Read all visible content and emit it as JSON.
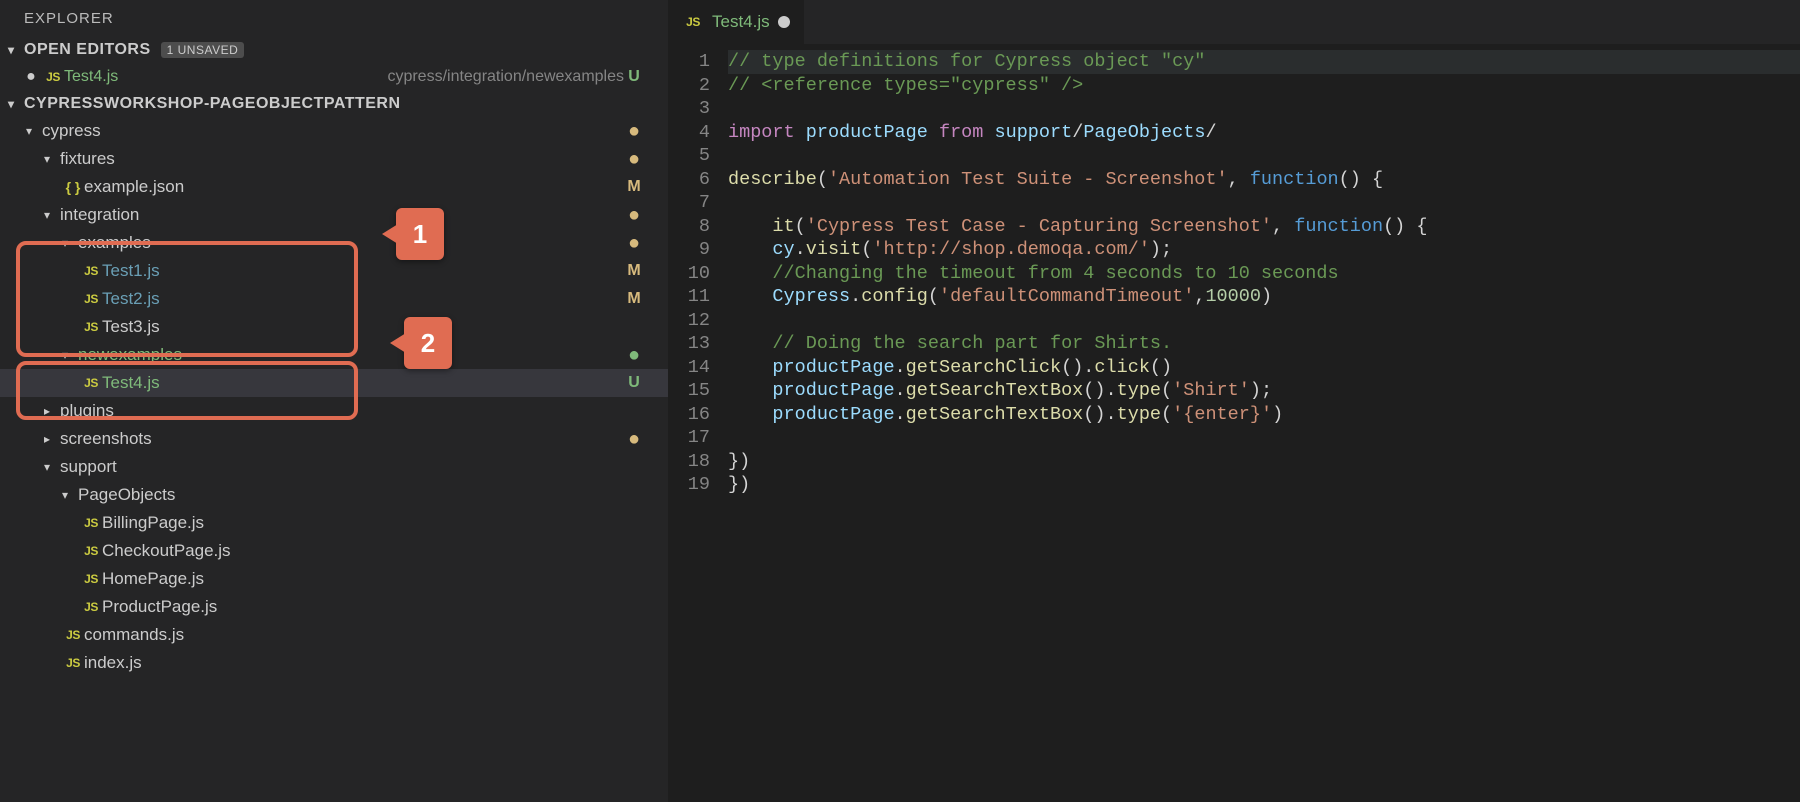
{
  "sidebar": {
    "title": "EXPLORER",
    "openEditors": {
      "label": "OPEN EDITORS",
      "unsavedBadge": "1 UNSAVED",
      "items": [
        {
          "name": "Test4.js",
          "path": "cypress/integration/newexamples",
          "git": "U"
        }
      ]
    },
    "workspace": {
      "name": "CYPRESSWORKSHOP-PAGEOBJECTPATTERN"
    },
    "tree": [
      {
        "type": "folder",
        "name": "cypress",
        "depth": 1,
        "open": true,
        "gitDot": "amber"
      },
      {
        "type": "folder",
        "name": "fixtures",
        "depth": 2,
        "open": true,
        "gitDot": "amber"
      },
      {
        "type": "file",
        "name": "example.json",
        "depth": 3,
        "icon": "json",
        "git": "M"
      },
      {
        "type": "folder",
        "name": "integration",
        "depth": 2,
        "open": true,
        "gitDot": "amber"
      },
      {
        "type": "folder",
        "name": "examples",
        "depth": 3,
        "open": true,
        "gitDot": "amber"
      },
      {
        "type": "file",
        "name": "Test1.js",
        "depth": 4,
        "icon": "js",
        "git": "M",
        "mod": "blue"
      },
      {
        "type": "file",
        "name": "Test2.js",
        "depth": 4,
        "icon": "js",
        "git": "M",
        "mod": "blue"
      },
      {
        "type": "file",
        "name": "Test3.js",
        "depth": 4,
        "icon": "js"
      },
      {
        "type": "folder",
        "name": "newexamples",
        "depth": 3,
        "open": true,
        "gitDot": "green",
        "mod": "green"
      },
      {
        "type": "file",
        "name": "Test4.js",
        "depth": 4,
        "icon": "js",
        "git": "U",
        "mod": "green",
        "selected": true
      },
      {
        "type": "folder",
        "name": "plugins",
        "depth": 2,
        "open": false
      },
      {
        "type": "folder",
        "name": "screenshots",
        "depth": 2,
        "open": false,
        "gitDot": "amber"
      },
      {
        "type": "folder",
        "name": "support",
        "depth": 2,
        "open": true
      },
      {
        "type": "folder",
        "name": "PageObjects",
        "depth": 3,
        "open": true
      },
      {
        "type": "file",
        "name": "BillingPage.js",
        "depth": 4,
        "icon": "js"
      },
      {
        "type": "file",
        "name": "CheckoutPage.js",
        "depth": 4,
        "icon": "js"
      },
      {
        "type": "file",
        "name": "HomePage.js",
        "depth": 4,
        "icon": "js"
      },
      {
        "type": "file",
        "name": "ProductPage.js",
        "depth": 4,
        "icon": "js"
      },
      {
        "type": "file",
        "name": "commands.js",
        "depth": 3,
        "icon": "js"
      },
      {
        "type": "file",
        "name": "index.js",
        "depth": 3,
        "icon": "js"
      }
    ]
  },
  "tab": {
    "label": "Test4.js"
  },
  "annotations": {
    "callout1": "1",
    "callout2": "2"
  },
  "code": {
    "lines": [
      [
        {
          "c": "comment",
          "t": "// type definitions for Cypress object \"cy\""
        }
      ],
      [
        {
          "c": "comment",
          "t": "// <reference types=\"cypress\" />"
        }
      ],
      [],
      [
        {
          "c": "keyword",
          "t": "import"
        },
        {
          "c": "plain",
          "t": " "
        },
        {
          "c": "var",
          "t": "productPage"
        },
        {
          "c": "plain",
          "t": " "
        },
        {
          "c": "keyword",
          "t": "from"
        },
        {
          "c": "plain",
          "t": " "
        },
        {
          "c": "var",
          "t": "support"
        },
        {
          "c": "plain",
          "t": "/"
        },
        {
          "c": "var",
          "t": "PageObjects"
        },
        {
          "c": "plain",
          "t": "/"
        }
      ],
      [],
      [
        {
          "c": "func",
          "t": "describe"
        },
        {
          "c": "plain",
          "t": "("
        },
        {
          "c": "string",
          "t": "'Automation Test Suite - Screenshot'"
        },
        {
          "c": "plain",
          "t": ", "
        },
        {
          "c": "type",
          "t": "function"
        },
        {
          "c": "plain",
          "t": "() {"
        }
      ],
      [],
      [
        {
          "c": "plain",
          "t": "    "
        },
        {
          "c": "func",
          "t": "it"
        },
        {
          "c": "plain",
          "t": "("
        },
        {
          "c": "string",
          "t": "'Cypress Test Case - Capturing Screenshot'"
        },
        {
          "c": "plain",
          "t": ", "
        },
        {
          "c": "type",
          "t": "function"
        },
        {
          "c": "plain",
          "t": "() {"
        }
      ],
      [
        {
          "c": "plain",
          "t": "    "
        },
        {
          "c": "var",
          "t": "cy"
        },
        {
          "c": "plain",
          "t": "."
        },
        {
          "c": "func",
          "t": "visit"
        },
        {
          "c": "plain",
          "t": "("
        },
        {
          "c": "string",
          "t": "'http://shop.demoqa.com/'"
        },
        {
          "c": "plain",
          "t": ");"
        }
      ],
      [
        {
          "c": "plain",
          "t": "    "
        },
        {
          "c": "comment",
          "t": "//Changing the timeout from 4 seconds to 10 seconds"
        }
      ],
      [
        {
          "c": "plain",
          "t": "    "
        },
        {
          "c": "var",
          "t": "Cypress"
        },
        {
          "c": "plain",
          "t": "."
        },
        {
          "c": "func",
          "t": "config"
        },
        {
          "c": "plain",
          "t": "("
        },
        {
          "c": "string",
          "t": "'defaultCommandTimeout'"
        },
        {
          "c": "plain",
          "t": ","
        },
        {
          "c": "num",
          "t": "10000"
        },
        {
          "c": "plain",
          "t": ")"
        }
      ],
      [],
      [
        {
          "c": "plain",
          "t": "    "
        },
        {
          "c": "comment",
          "t": "// Doing the search part for Shirts."
        }
      ],
      [
        {
          "c": "plain",
          "t": "    "
        },
        {
          "c": "var",
          "t": "productPage"
        },
        {
          "c": "plain",
          "t": "."
        },
        {
          "c": "func",
          "t": "getSearchClick"
        },
        {
          "c": "plain",
          "t": "()."
        },
        {
          "c": "func",
          "t": "click"
        },
        {
          "c": "plain",
          "t": "()"
        }
      ],
      [
        {
          "c": "plain",
          "t": "    "
        },
        {
          "c": "var",
          "t": "productPage"
        },
        {
          "c": "plain",
          "t": "."
        },
        {
          "c": "func",
          "t": "getSearchTextBox"
        },
        {
          "c": "plain",
          "t": "()."
        },
        {
          "c": "func",
          "t": "type"
        },
        {
          "c": "plain",
          "t": "("
        },
        {
          "c": "string",
          "t": "'Shirt'"
        },
        {
          "c": "plain",
          "t": ");"
        }
      ],
      [
        {
          "c": "plain",
          "t": "    "
        },
        {
          "c": "var",
          "t": "productPage"
        },
        {
          "c": "plain",
          "t": "."
        },
        {
          "c": "func",
          "t": "getSearchTextBox"
        },
        {
          "c": "plain",
          "t": "()."
        },
        {
          "c": "func",
          "t": "type"
        },
        {
          "c": "plain",
          "t": "("
        },
        {
          "c": "string",
          "t": "'{enter}'"
        },
        {
          "c": "plain",
          "t": ")"
        }
      ],
      [],
      [
        {
          "c": "plain",
          "t": "})"
        }
      ],
      [
        {
          "c": "plain",
          "t": "})"
        }
      ]
    ]
  }
}
